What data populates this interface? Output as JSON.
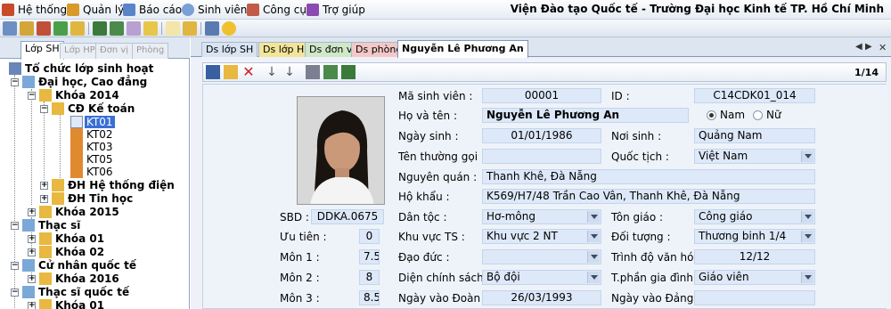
{
  "menu": {
    "items": [
      {
        "label": "Hệ thống",
        "icon": "system-icon"
      },
      {
        "label": "Quản lý",
        "icon": "manage-icon"
      },
      {
        "label": "Báo cáo",
        "icon": "report-icon"
      },
      {
        "label": "Sinh viên",
        "icon": "student-icon"
      },
      {
        "label": "Công cụ",
        "icon": "tools-icon"
      },
      {
        "label": "Trợ giúp",
        "icon": "help-icon"
      }
    ],
    "app_title": "Viện Đào tạo Quốc tế - Trường Đại học Kinh tế TP. Hồ Chí Minh"
  },
  "left_tabs": [
    "Lớp SH",
    "Lớp HP",
    "Đơn vị",
    "Phòng"
  ],
  "tree": {
    "root": "Tổ chức lớp sinh hoạt",
    "n1": "Đại học, Cao đẳng",
    "n1a": "Khóa 2014",
    "n1a1": "CĐ Kế toán",
    "kt01": "KT01",
    "kt02": "KT02",
    "kt03": "KT03",
    "kt05": "KT05",
    "kt06": "KT06",
    "n1a2": "ĐH Hệ thống điện",
    "n1a3": "ĐH Tin học",
    "n1b": "Khóa 2015",
    "n2": "Thạc sĩ",
    "n2a": "Khóa 01",
    "n2b": "Khóa 02",
    "n3": "Cử nhân quốc tế",
    "n3a": "Khóa 2016",
    "n4": "Thạc sĩ quốc tế",
    "n4a": "Khóa 01"
  },
  "right_tabs": [
    "Ds lớp SH",
    "Ds lớp HP",
    "Ds đơn vị",
    "Ds phòng",
    "Nguyễn Lê Phương An"
  ],
  "record_position": "1/14",
  "form": {
    "lbl_masv": "Mã sinh viên :",
    "masv": "00001",
    "lbl_id": "ID :",
    "id": "C14CDK01_014",
    "lbl_hoten": "Họ và tên :",
    "hoten": "Nguyễn Lê Phương An",
    "gender_male": "Nam",
    "gender_female": "Nữ",
    "lbl_ngaysinh": "Ngày sinh :",
    "ngaysinh": "01/01/1986",
    "lbl_noisinh": "Nơi sinh :",
    "noisinh": "Quảng Nam",
    "lbl_tenthuonggoi": "Tên thường gọi :",
    "tenthuonggoi": "",
    "lbl_quoctich": "Quốc tịch :",
    "quoctich": "Việt Nam",
    "lbl_nguyenquan": "Nguyên quán :",
    "nguyenquan": "Thanh Khê, Đà Nẵng",
    "lbl_hokhau": "Hộ khẩu :",
    "hokhau": "K569/H7/48 Trần Cao Vân, Thanh Khê, Đà Nẵng",
    "lbl_sbd": "SBD :",
    "sbd": "DDKA.0675",
    "lbl_dantoc": "Dân tộc :",
    "dantoc": "Hơ-mông",
    "lbl_tongiao": "Tôn giáo :",
    "tongiao": "Công giáo",
    "lbl_uutien": "Ưu tiên :",
    "uutien": "0",
    "lbl_khuvuc": "Khu vực TS :",
    "khuvuc": "Khu vực 2 NT",
    "lbl_doituong": "Đối tượng :",
    "doituong": "Thương binh 1/4",
    "lbl_mon1": "Môn 1 :",
    "mon1": "7.5",
    "lbl_daoduc": "Đạo đức :",
    "daoduc": "",
    "lbl_trinhdo": "Trình độ văn hóa :",
    "trinhdo": "12/12",
    "lbl_mon2": "Môn 2 :",
    "mon2": "8",
    "lbl_dienchinhsach": "Diện chính sách :",
    "dienchinhsach": "Bộ đội",
    "lbl_tphan": "T.phần gia đình :",
    "tphan": "Giáo viên",
    "lbl_mon3": "Môn 3 :",
    "mon3": "8.5",
    "lbl_ngayvaodoan": "Ngày vào Đoàn :",
    "ngayvaodoan": "26/03/1993",
    "lbl_ngayvaodang": "Ngày vào Đảng :",
    "ngayvaodang": ""
  },
  "colors": {
    "accent": "#3a6fd4",
    "field_bg": "#dde8f8",
    "panel_bg": "#eef3fa"
  }
}
